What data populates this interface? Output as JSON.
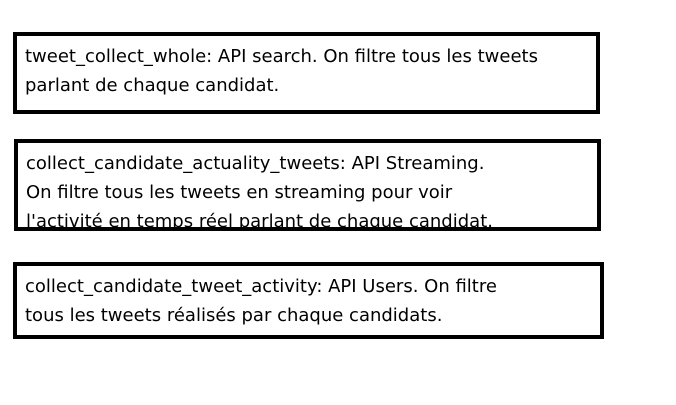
{
  "boxes": [
    {
      "lines": [
        "tweet_collect_whole: API search. On filtre tous les tweets",
        "parlant de chaque candidat."
      ]
    },
    {
      "lines": [
        "collect_candidate_actuality_tweets: API Streaming.",
        "On filtre tous les tweets en streaming pour voir",
        "l'activité en temps réel parlant de chaque candidat."
      ]
    },
    {
      "lines": [
        "collect_candidate_tweet_activity: API Users. On filtre",
        "tous les tweets réalisés par chaque candidats."
      ]
    }
  ],
  "colors": {
    "border": "#000000",
    "text": "#000000",
    "background": "#ffffff"
  }
}
